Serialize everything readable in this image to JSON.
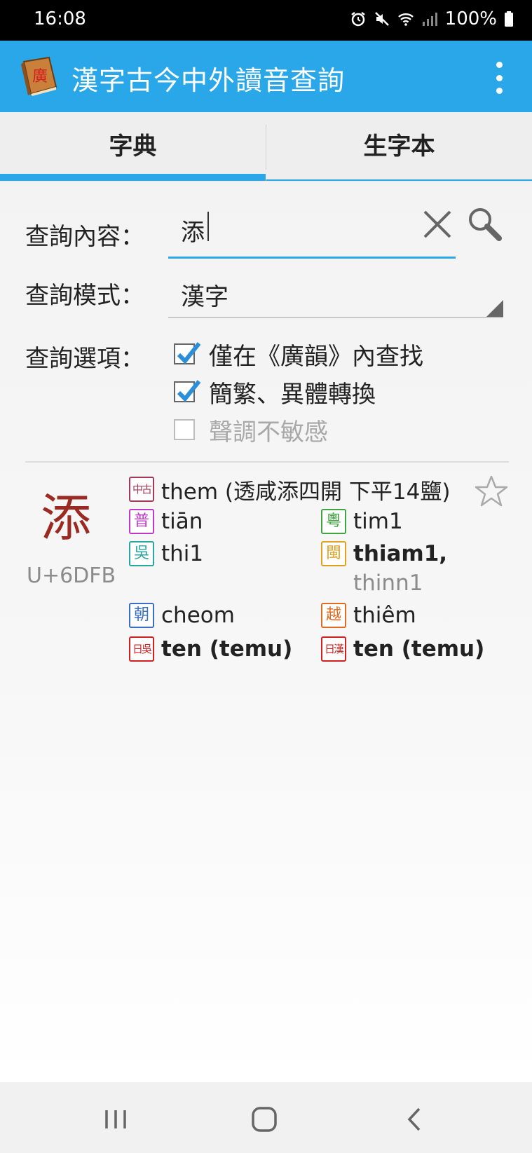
{
  "status_bar": {
    "time": "16:08",
    "battery": "100%",
    "icons": [
      "alarm-icon",
      "mute-icon",
      "wifi-icon",
      "signal-icon",
      "battery-icon"
    ]
  },
  "app_bar": {
    "title": "漢字古今中外讀音查詢",
    "logo_glyph": "廣",
    "menu_icon": "more-vert-icon"
  },
  "tabs": [
    {
      "label": "字典",
      "selected": true
    },
    {
      "label": "生字本",
      "selected": false
    }
  ],
  "search": {
    "label": "查詢內容：",
    "value": "添"
  },
  "mode": {
    "label": "查詢模式：",
    "value": "漢字"
  },
  "options": {
    "label": "查詢選項：",
    "items": [
      {
        "label": "僅在《廣韻》內查找",
        "checked": true,
        "enabled": true
      },
      {
        "label": "簡繁、異體轉換",
        "checked": true,
        "enabled": true
      },
      {
        "label": "聲調不敏感",
        "checked": false,
        "enabled": false
      }
    ]
  },
  "result": {
    "character": "添",
    "codepoint": "U+6DFB",
    "favorite": false,
    "middle_chinese": {
      "badge": "中古",
      "text": "them (透咸添四開 下平14鹽)",
      "color": "#a33a5a"
    },
    "readings": [
      {
        "badge": "普",
        "text": "tiān",
        "color": "#c038c8",
        "bold": false
      },
      {
        "badge": "粵",
        "text": "tim1",
        "color": "#3fa33f",
        "bold": false
      },
      {
        "badge": "吳",
        "text": "thi1",
        "color": "#2aa7a0",
        "bold": false
      },
      {
        "badge": "閩",
        "text": "thiam1,",
        "extra": "thinn1",
        "color": "#e0a020",
        "bold": true
      },
      {
        "badge": "朝",
        "text": "cheom",
        "color": "#3a6fc8",
        "bold": false
      },
      {
        "badge": "越",
        "text": "thiêm",
        "color": "#e06a20",
        "bold": false
      },
      {
        "badge": "日吳",
        "text": "ten (temu)",
        "color": "#d02020",
        "bold": true
      },
      {
        "badge": "日漢",
        "text": "ten (temu)",
        "color": "#d02020",
        "bold": true
      }
    ]
  },
  "nav_bar": {
    "icons": [
      "recents-icon",
      "home-icon",
      "back-icon"
    ]
  }
}
